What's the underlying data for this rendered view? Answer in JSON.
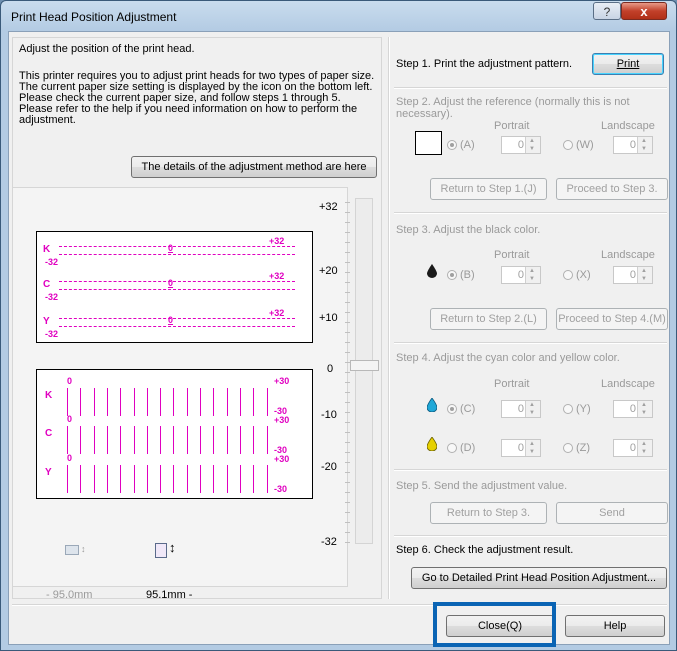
{
  "window": {
    "title": "Print Head Position Adjustment",
    "help_glyph": "?",
    "close_glyph": "x"
  },
  "left": {
    "heading": "Adjust the position of the print head.",
    "desc": [
      "This printer requires you to adjust print heads for two types of paper size.",
      "The current paper size setting is displayed by the icon on the bottom left.",
      "Please check the current paper size, and follow steps 1 through 5.",
      "Please refer to the help if you need information on how to perform the",
      "adjustment."
    ],
    "details_button": "The details of the adjustment method are here",
    "pattern_top": {
      "labels": [
        "K",
        "C",
        "Y"
      ],
      "plus": "+32",
      "minus": "-32",
      "zero": "0"
    },
    "pattern_bottom": {
      "labels": [
        "K",
        "C",
        "Y"
      ],
      "plus": "+30",
      "minus": "-30",
      "zero": "0"
    },
    "scale": [
      "+32",
      "+20",
      "+10",
      "0",
      "-10",
      "-20",
      "-32"
    ],
    "size_left": "- 95.0mm",
    "size_right": "95.1mm -"
  },
  "step1": {
    "label": "Step 1. Print the adjustment pattern.",
    "print_button": "Print"
  },
  "step2": {
    "label": "Step 2. Adjust the reference (normally this is not necessary).",
    "portrait": "Portrait",
    "landscape": "Landscape",
    "opt_a": "(A)",
    "opt_w": "(W)",
    "val_a": "0",
    "val_w": "0",
    "return_button": "Return to Step 1.(J)",
    "proceed_button": "Proceed to Step 3."
  },
  "step3": {
    "label": "Step 3. Adjust the black color.",
    "portrait": "Portrait",
    "landscape": "Landscape",
    "opt_b": "(B)",
    "opt_x": "(X)",
    "val_b": "0",
    "val_x": "0",
    "return_button": "Return to Step 2.(L)",
    "proceed_button": "Proceed to Step 4.(M)"
  },
  "step4": {
    "label": "Step 4. Adjust the cyan color and yellow color.",
    "portrait": "Portrait",
    "landscape": "Landscape",
    "opt_c": "(C)",
    "opt_y": "(Y)",
    "opt_d": "(D)",
    "opt_z": "(Z)",
    "val_c": "0",
    "val_y": "0",
    "val_d": "0",
    "val_z": "0"
  },
  "step5": {
    "label": "Step 5. Send the adjustment value.",
    "return_button": "Return to Step 3.",
    "send_button": "Send"
  },
  "step6": {
    "label": "Step 6. Check the adjustment result.",
    "detailed_button": "Go to Detailed Print Head Position Adjustment..."
  },
  "footer": {
    "close_button": "Close(Q)",
    "help_button": "Help"
  },
  "colors": {
    "magenta": "#e000c0",
    "black_ink": "#1a1a1a",
    "cyan_ink": "#1fa8d8",
    "yellow_ink": "#e6d000",
    "highlight": "#0a64b4"
  }
}
